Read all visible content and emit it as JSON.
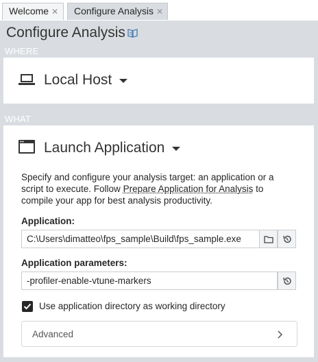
{
  "tabs": [
    {
      "label": "Welcome",
      "close": "✕",
      "active": false
    },
    {
      "label": "Configure Analysis",
      "close": "✕",
      "active": true
    }
  ],
  "page_title": "Configure Analysis",
  "where": {
    "section_label": "WHERE",
    "host_label": "Local Host",
    "host_icon": "laptop-icon"
  },
  "what": {
    "section_label": "WHAT",
    "launch_label": "Launch Application",
    "launch_icon": "application-window-icon",
    "description_before": "Specify and configure your analysis target: an application or a script to execute. Follow ",
    "description_link": "Prepare Application for Analysis",
    "description_after": " to compile your app for best analysis productivity.",
    "application_label": "Application:",
    "application_value": "C:\\Users\\dimatteo\\fps_sample\\Build\\fps_sample.exe",
    "params_label": "Application parameters:",
    "params_value": "-profiler-enable-vtune-markers",
    "use_app_dir_label": "Use application directory as working directory",
    "use_app_dir_checked": true,
    "advanced_label": "Advanced"
  },
  "colors": {
    "background": "#d9dde1",
    "panel": "#ffffff",
    "text": "#262626",
    "section_label": "#ffffff"
  }
}
